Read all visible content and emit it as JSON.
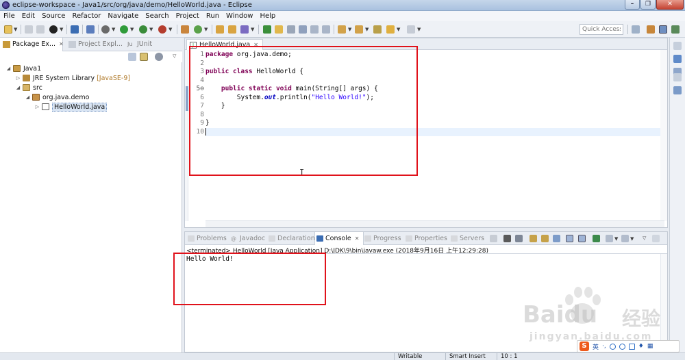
{
  "window": {
    "title": "eclipse-workspace - Java1/src/org/java/demo/HelloWorld.java - Eclipse"
  },
  "menubar": [
    "File",
    "Edit",
    "Source",
    "Refactor",
    "Navigate",
    "Search",
    "Project",
    "Run",
    "Window",
    "Help"
  ],
  "toolbar": {
    "quick_access_placeholder": "Quick Access"
  },
  "left_panel": {
    "tabs": [
      {
        "label": "Package Ex...",
        "active": true
      },
      {
        "label": "Project Expl...",
        "active": false
      },
      {
        "label": "JUnit",
        "active": false
      }
    ],
    "tree": [
      {
        "label": "Java1",
        "depth": 0,
        "icon": "java-project-icon"
      },
      {
        "label": "JRE System Library",
        "decoration": "[JavaSE-9]",
        "depth": 1,
        "icon": "library-icon"
      },
      {
        "label": "src",
        "depth": 1,
        "icon": "source-folder-icon"
      },
      {
        "label": "org.java.demo",
        "depth": 2,
        "icon": "package-icon"
      },
      {
        "label": "HelloWorld.java",
        "depth": 3,
        "icon": "java-file-icon",
        "selected": true
      }
    ]
  },
  "editor": {
    "tab_label": "HelloWorld.java",
    "line_numbers": [
      "1",
      "2",
      "3",
      "4",
      "5⊖",
      "6",
      "7",
      "8",
      "9",
      "10"
    ],
    "code": {
      "l1_kw": "package",
      "l1_rest": " org.java.demo;",
      "l3_kw": "public class",
      "l3_rest": " HelloWorld {",
      "l5_kw": "public static void",
      "l5_rest": " main(String[] args) {",
      "l6_pre": "System.",
      "l6_field": "out",
      "l6_mid": ".println(",
      "l6_str": "\"Hello World!\"",
      "l6_post": ");",
      "l7": "}",
      "l9": "}"
    },
    "cursor": "10 : 1"
  },
  "console": {
    "tabs": [
      "Problems",
      "Javadoc",
      "Declaration",
      "Console",
      "Progress",
      "Properties",
      "Servers"
    ],
    "active_tab": "Console",
    "description": "<terminated> HelloWorld [Java Application] D:\\JDK\\9\\bin\\javaw.exe (2018年9月16日 上午12:29:28)",
    "output": "Hello World!"
  },
  "statusbar": {
    "writable": "Writable",
    "insert_mode": "Smart Insert",
    "position": "10 : 1"
  },
  "watermark": {
    "brand": "Baidu",
    "brand_cn": "经验",
    "url": "jingyan.baidu.com"
  },
  "ime": {
    "badge": "S",
    "lang": "英"
  },
  "colors": {
    "highlight_box": "#e0121b",
    "keyword": "#7f0055",
    "string": "#2a00ff"
  }
}
